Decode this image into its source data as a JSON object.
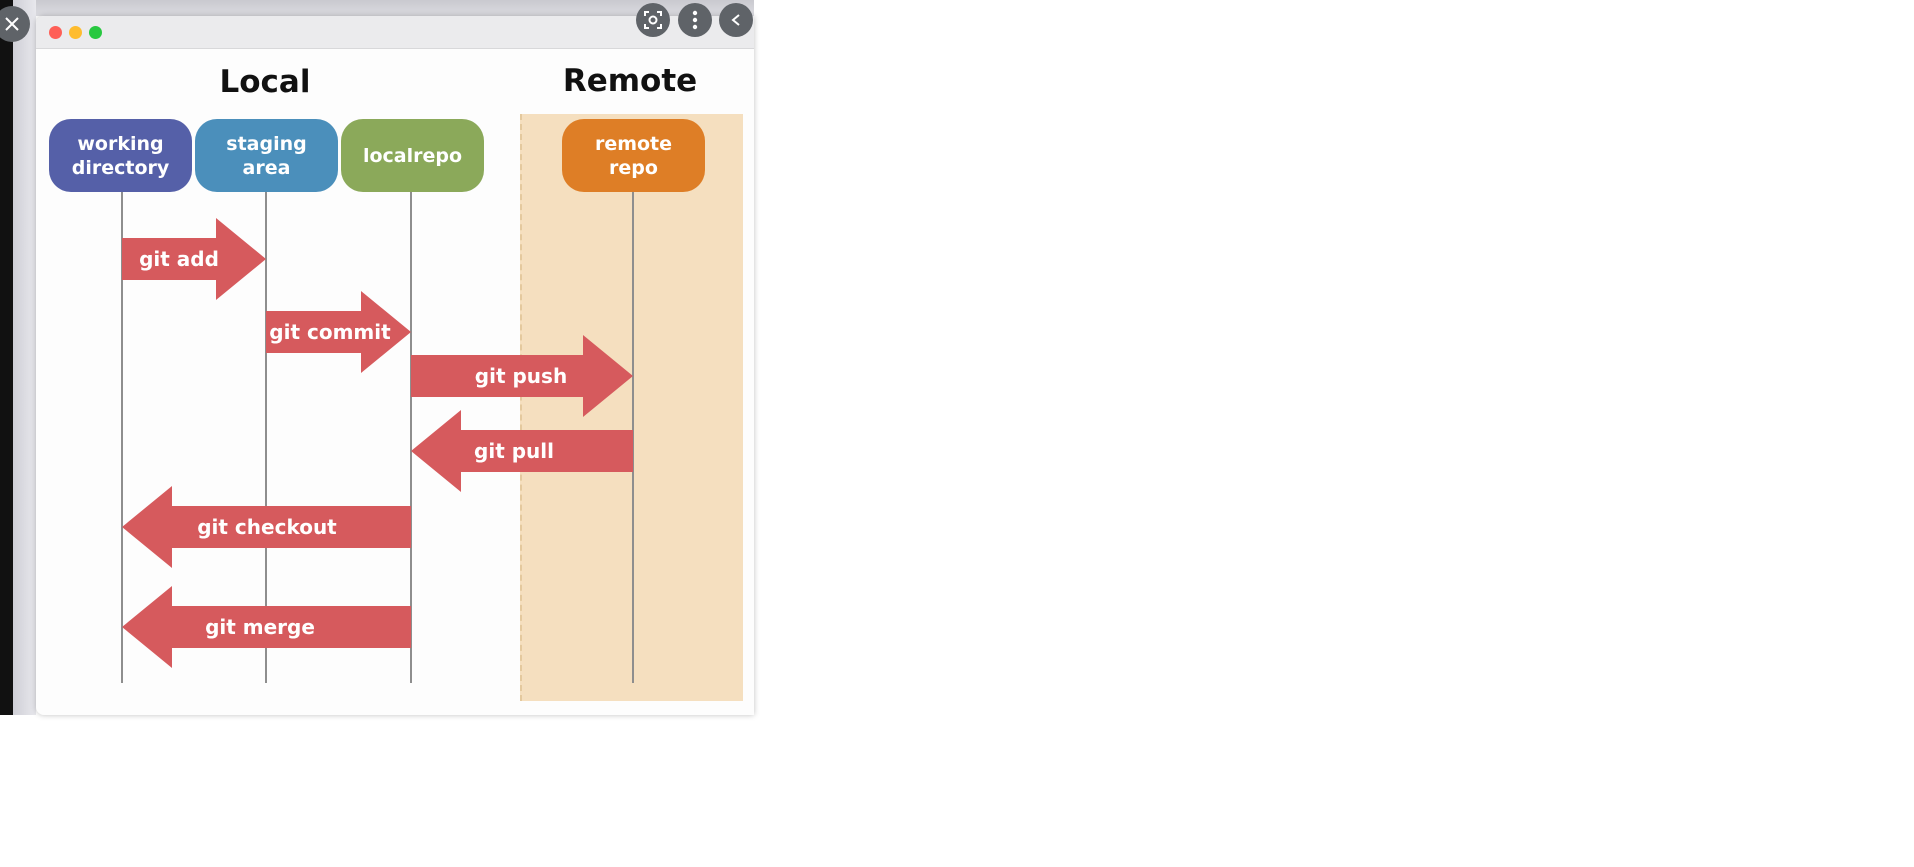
{
  "window": {
    "traffic_lights": [
      "close",
      "minimize",
      "zoom"
    ]
  },
  "controls": {
    "close_icon": "close-icon",
    "lens_icon": "lens-icon",
    "more_icon": "more-vert-icon",
    "collapse_icon": "chevron-left-icon"
  },
  "diagram": {
    "local_heading": "Local",
    "remote_heading": "Remote",
    "nodes": [
      {
        "label_line1": "working",
        "label_line2": "directory",
        "color": "#5560a8"
      },
      {
        "label_line1": "staging",
        "label_line2": "area",
        "color": "#4b8fbb"
      },
      {
        "label_line1": "localrepo",
        "label_line2": "",
        "color": "#8ba95a"
      },
      {
        "label_line1": "remote",
        "label_line2": "repo",
        "color": "#de7e26"
      }
    ],
    "arrows": [
      {
        "label": "git add",
        "from": "working directory",
        "to": "staging area"
      },
      {
        "label": "git commit",
        "from": "staging area",
        "to": "localrepo"
      },
      {
        "label": "git push",
        "from": "localrepo",
        "to": "remote repo"
      },
      {
        "label": "git pull",
        "from": "remote repo",
        "to": "localrepo"
      },
      {
        "label": "git checkout",
        "from": "localrepo",
        "to": "working directory"
      },
      {
        "label": "git merge",
        "from": "localrepo",
        "to": "working directory"
      }
    ],
    "arrow_color": "#d65a5d",
    "remote_zone_color": "#f5dfbf"
  }
}
